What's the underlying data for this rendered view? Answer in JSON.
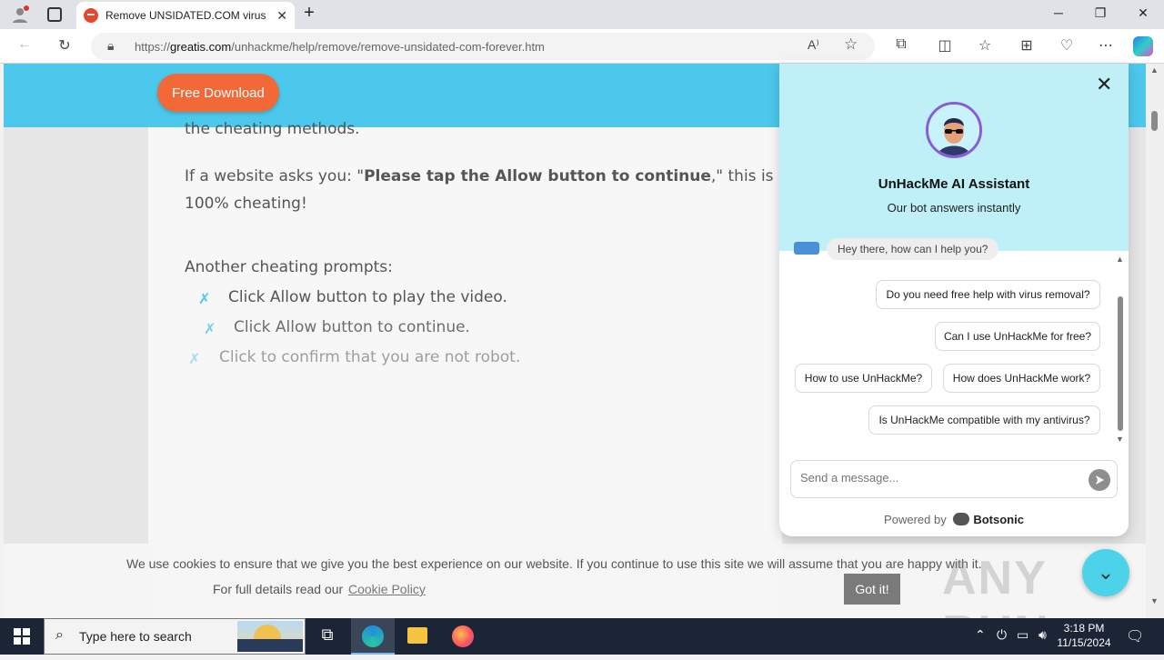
{
  "browser": {
    "tab_title": "Remove UNSIDATED.COM virus (",
    "url_prefix": "https://",
    "url_domain": "greatis.com",
    "url_path": "/unhackme/help/remove/remove-unsidated-com-forever.htm"
  },
  "page": {
    "free_download": "Free Download",
    "line1": "the cheating methods.",
    "line2a": "If a website asks you: \"",
    "line2_bold": "Please tap the Allow button to continue",
    "line2b": ",\" this is",
    "line3": "100% cheating!",
    "another": "Another cheating prompts:",
    "prompts": [
      "Click Allow button to play the video.",
      "Click Allow button to continue.",
      "Click to confirm that you are not robot."
    ],
    "x_glyph": "✗"
  },
  "chat": {
    "bot_name": "UnHackMe AI Assistant",
    "bot_sub": "Our bot answers instantly",
    "greeting": "Hey there, how can I help you?",
    "suggestions": [
      "Do you need free help with virus removal?",
      "Can I use UnHackMe for free?",
      "How to use UnHackMe?",
      "How does UnHackMe work?",
      "Is UnHackMe compatible with my antivirus?"
    ],
    "input_placeholder": "Send a message...",
    "powered_by": "Powered by",
    "brand": "Botsonic"
  },
  "cookie": {
    "text1": "We use cookies to ensure that we give you the best experience on our website. If you continue to use this site we will assume that you are happy with it.",
    "text2": "For full details read our",
    "link": "Cookie Policy",
    "button": "Got it!"
  },
  "watermark": "ANY RUN",
  "taskbar": {
    "search_placeholder": "Type here to search",
    "time": "3:18 PM",
    "date": "11/15/2024"
  }
}
